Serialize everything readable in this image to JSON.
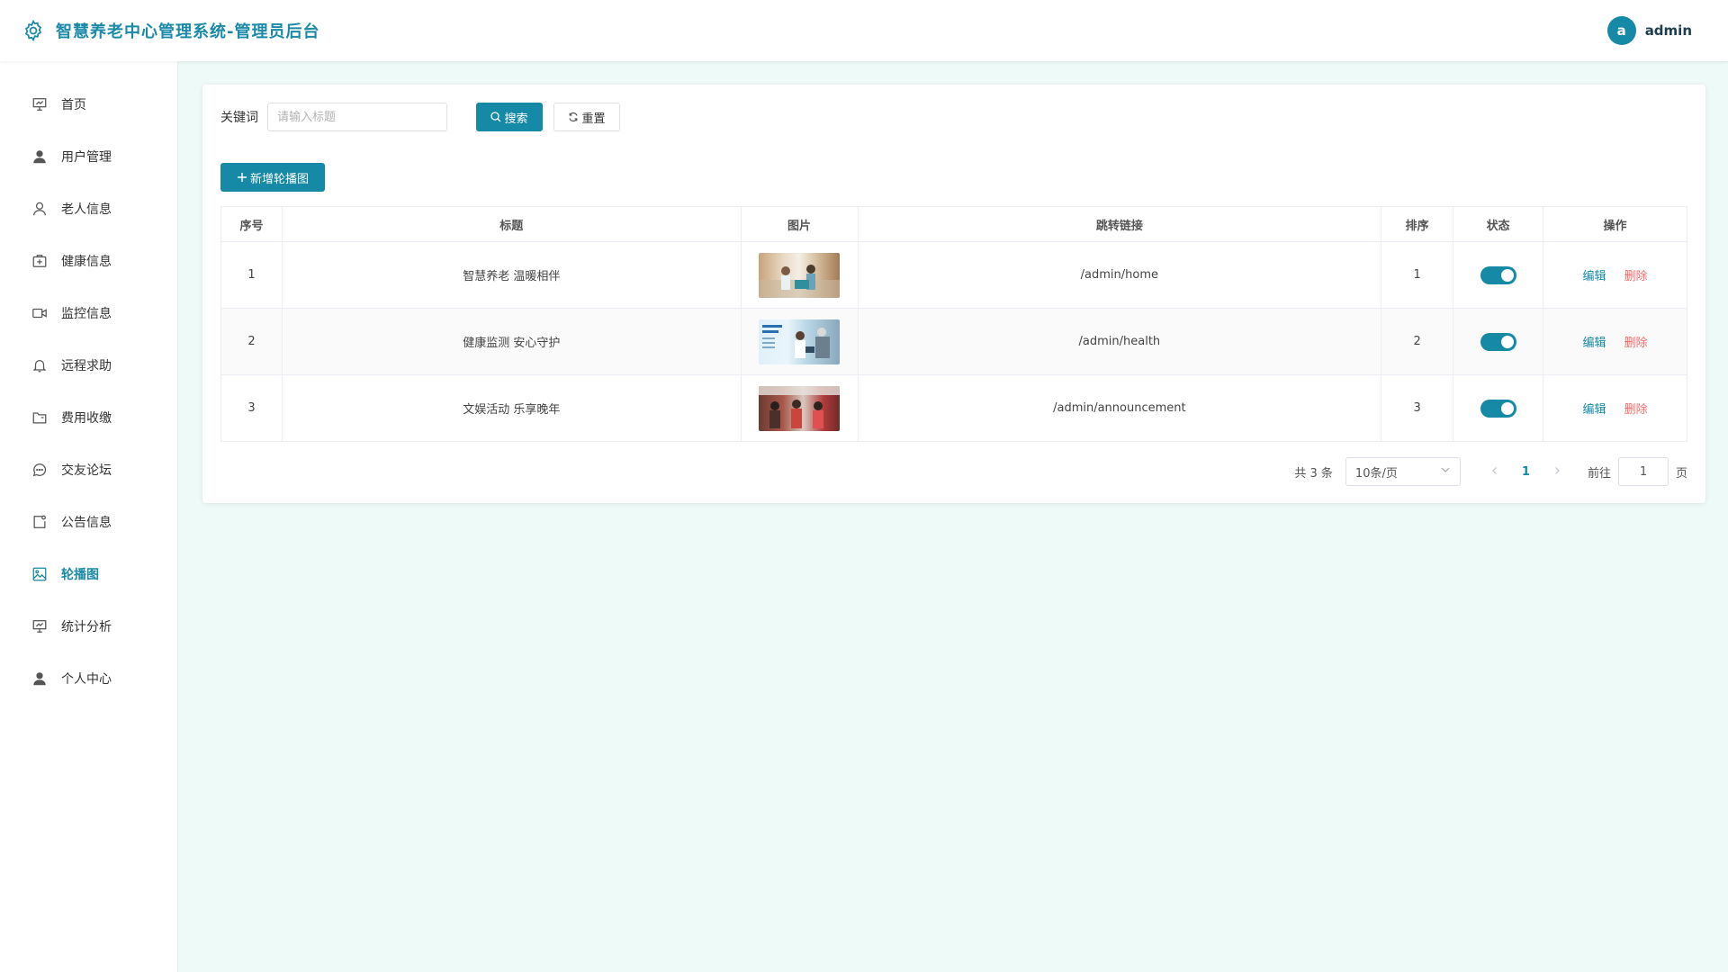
{
  "header": {
    "title": "智慧养老中心管理系统-管理员后台",
    "avatar_letter": "a",
    "username": "admin",
    "brand_color": "#1589a6"
  },
  "sidebar": {
    "items": [
      {
        "label": "首页",
        "icon": "presentation-icon"
      },
      {
        "label": "用户管理",
        "icon": "user-icon"
      },
      {
        "label": "老人信息",
        "icon": "user-outline-icon"
      },
      {
        "label": "健康信息",
        "icon": "first-aid-kit-icon"
      },
      {
        "label": "监控信息",
        "icon": "video-camera-icon"
      },
      {
        "label": "远程求助",
        "icon": "bell-icon"
      },
      {
        "label": "费用收缴",
        "icon": "folder-icon"
      },
      {
        "label": "交友论坛",
        "icon": "chat-icon"
      },
      {
        "label": "公告信息",
        "icon": "notice-icon"
      },
      {
        "label": "轮播图",
        "icon": "picture-icon",
        "active": true
      },
      {
        "label": "统计分析",
        "icon": "presentation-icon"
      },
      {
        "label": "个人中心",
        "icon": "user-icon"
      }
    ]
  },
  "search": {
    "label": "关键词",
    "placeholder": "请输入标题",
    "search_label": "搜索",
    "reset_label": "重置"
  },
  "toolbar": {
    "add_label": "新增轮播图"
  },
  "table": {
    "columns": [
      "序号",
      "标题",
      "图片",
      "跳转链接",
      "排序",
      "状态",
      "操作"
    ],
    "rows": [
      {
        "index": "1",
        "title": "智慧养老 温暖相伴",
        "link": "/admin/home",
        "sort": "1",
        "enabled": true
      },
      {
        "index": "2",
        "title": "健康监测 安心守护",
        "link": "/admin/health",
        "sort": "2",
        "enabled": true
      },
      {
        "index": "3",
        "title": "文娱活动 乐享晚年",
        "link": "/admin/announcement",
        "sort": "3",
        "enabled": true
      }
    ],
    "edit_label": "编辑",
    "delete_label": "删除"
  },
  "pagination": {
    "total": "共 3 条",
    "page_size": "10条/页",
    "current_page": "1",
    "goto_label": "前往",
    "goto_value": "1",
    "goto_suffix": "页"
  }
}
